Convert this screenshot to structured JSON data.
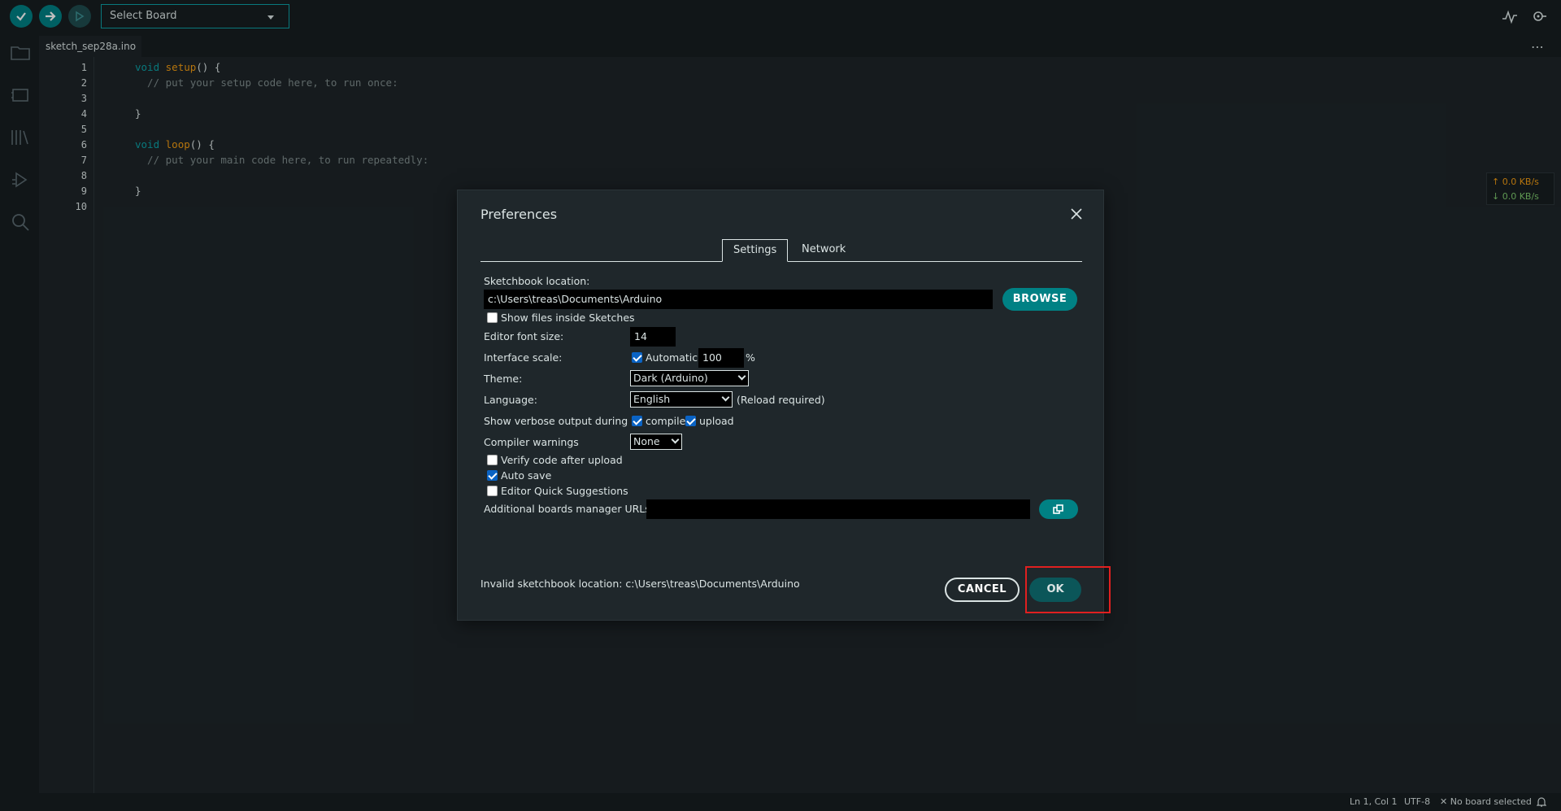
{
  "toolbar": {
    "verify": "verify-icon",
    "upload": "upload-icon",
    "debug": "debug-icon",
    "board_select": "Select Board"
  },
  "tab": {
    "filename": "sketch_sep28a.ino"
  },
  "editor": {
    "lines": [
      "1",
      "2",
      "3",
      "4",
      "5",
      "6",
      "7",
      "8",
      "9",
      "10"
    ],
    "code": {
      "l1_kw": "void",
      "l1_fn": "setup",
      "l1_rest": "() {",
      "l2": "  // put your setup code here, to run once:",
      "l4": "}",
      "l6_kw": "void",
      "l6_fn": "loop",
      "l6_rest": "() {",
      "l7": "  // put your main code here, to run repeatedly:",
      "l9": "}"
    }
  },
  "network": {
    "up": "↑ 0.0 KB/s",
    "down": "↓ 0.0 KB/s"
  },
  "status": {
    "position": "Ln 1, Col 1",
    "encoding": "UTF-8",
    "board": "✕ No board selected"
  },
  "dialog": {
    "title": "Preferences",
    "tabs": [
      "Settings",
      "Network"
    ],
    "sketchbook_label": "Sketchbook location:",
    "sketchbook_value": "c:\\Users\\treas\\Documents\\Arduino",
    "browse": "BROWSE",
    "show_files": "Show files inside Sketches",
    "font_size_label": "Editor font size:",
    "font_size_value": "14",
    "scale_label": "Interface scale:",
    "automatic": "Automatic",
    "scale_value": "100",
    "percent": "%",
    "theme_label": "Theme:",
    "theme_value": "Dark (Arduino)",
    "language_label": "Language:",
    "language_value": "English",
    "reload": "(Reload required)",
    "verbose_label": "Show verbose output during",
    "compile": "compile",
    "upload": "upload",
    "warnings_label": "Compiler warnings",
    "warnings_value": "None",
    "verify_after": "Verify code after upload",
    "auto_save": "Auto save",
    "quick_suggest": "Editor Quick Suggestions",
    "urls_label": "Additional boards manager URLs:",
    "urls_value": "",
    "invalid_msg": "Invalid sketchbook location: c:\\Users\\treas\\Documents\\Arduino",
    "cancel": "CANCEL",
    "ok": "OK"
  },
  "colors": {
    "accent": "#008184",
    "highlight": "#e02020"
  }
}
